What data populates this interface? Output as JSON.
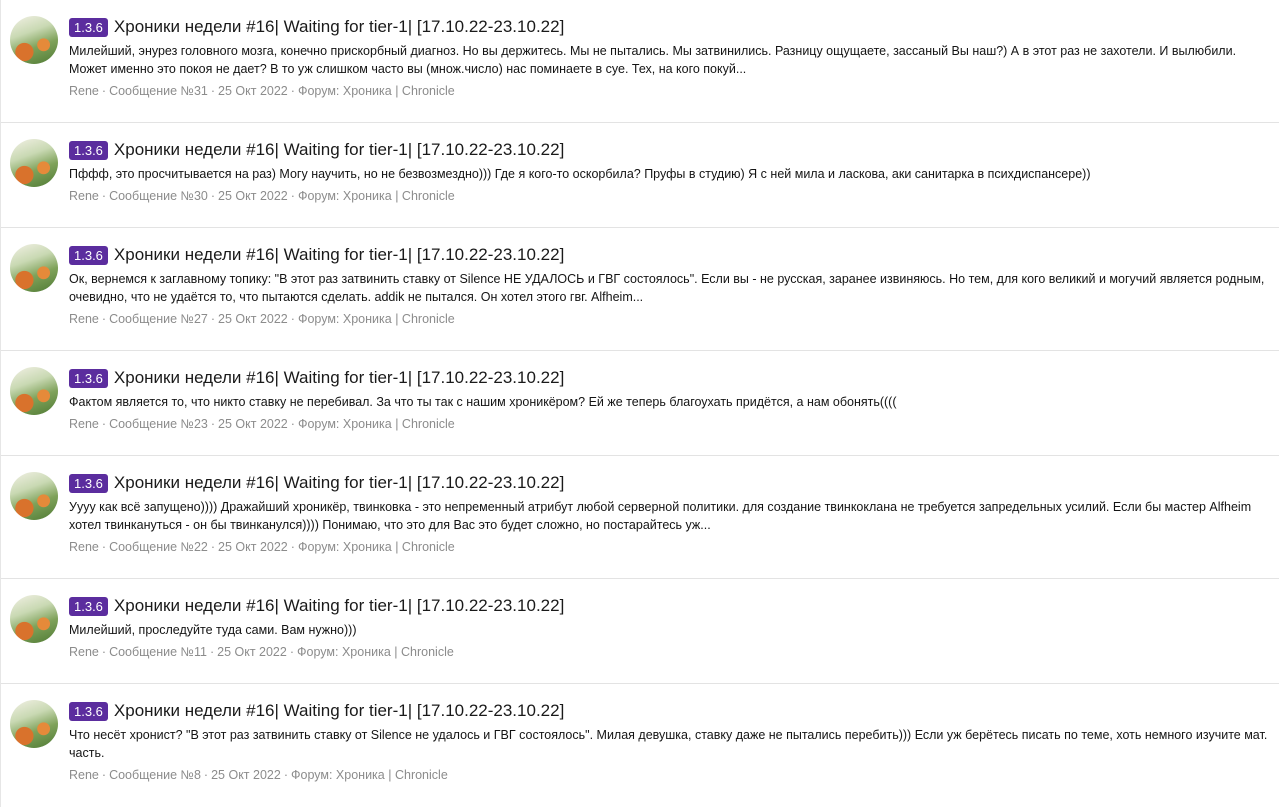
{
  "results": [
    {
      "version": "1.3.6",
      "title": "Хроники недели #16| Waiting for tier-1| [17.10.22-23.10.22]",
      "snippet": "Милейший, энурез головного мозга, конечно прискорбный диагноз. Но вы держитесь. Мы не пытались. Мы затвинились. Разницу ощущаете, зассаный Вы наш?) А в этот раз не захотели. И вылюбили. Может именно это покоя не дает? В то уж слишком часто вы (множ.число) нас поминаете в суе. Тех, на кого покуй...",
      "author": "Rene",
      "message": "Сообщение №31",
      "date": "25 Окт 2022",
      "forum_label": "Форум:",
      "forum": "Хроника",
      "forum_sep": "|",
      "forum_alt": "Chronicle"
    },
    {
      "version": "1.3.6",
      "title": "Хроники недели #16| Waiting for tier-1| [17.10.22-23.10.22]",
      "snippet": "Пффф, это просчитывается на раз) Могу научить, но не безвозмездно))) Где я кого-то оскорбила? Пруфы в студию) Я с ней мила и ласкова, аки санитарка в психдиспансере))",
      "author": "Rene",
      "message": "Сообщение №30",
      "date": "25 Окт 2022",
      "forum_label": "Форум:",
      "forum": "Хроника",
      "forum_sep": "|",
      "forum_alt": "Chronicle"
    },
    {
      "version": "1.3.6",
      "title": "Хроники недели #16| Waiting for tier-1| [17.10.22-23.10.22]",
      "snippet": "Ок, вернемся к заглавному топику: \"В этот раз затвинить ставку от Silence НЕ УДАЛОСЬ и ГВГ состоялось\". Если вы - не русская, заранее извиняюсь. Но тем, для кого великий и могучий является родным, очевидно, что не удаётся то, что пытаются сделать. addik не пытался. Он хотел этого гвг. Alfheim...",
      "author": "Rene",
      "message": "Сообщение №27",
      "date": "25 Окт 2022",
      "forum_label": "Форум:",
      "forum": "Хроника",
      "forum_sep": "|",
      "forum_alt": "Chronicle"
    },
    {
      "version": "1.3.6",
      "title": "Хроники недели #16| Waiting for tier-1| [17.10.22-23.10.22]",
      "snippet": "Фактом является то, что никто ставку не перебивал. За что ты так с нашим хроникёром? Ей же теперь благоухать придётся, а нам обонять((((",
      "author": "Rene",
      "message": "Сообщение №23",
      "date": "25 Окт 2022",
      "forum_label": "Форум:",
      "forum": "Хроника",
      "forum_sep": "|",
      "forum_alt": "Chronicle"
    },
    {
      "version": "1.3.6",
      "title": "Хроники недели #16| Waiting for tier-1| [17.10.22-23.10.22]",
      "snippet": "Уууу как всё запущено)))) Дражайший хроникёр, твинковка - это непременный атрибут любой серверной политики. для создание твинкоклана не требуется запредельных усилий. Если бы мастер Alfheim хотел твинкануться - он бы твинканулся)))) Понимаю, что это для Вас это будет сложно, но постарайтесь уж...",
      "author": "Rene",
      "message": "Сообщение №22",
      "date": "25 Окт 2022",
      "forum_label": "Форум:",
      "forum": "Хроника",
      "forum_sep": "|",
      "forum_alt": "Chronicle"
    },
    {
      "version": "1.3.6",
      "title": "Хроники недели #16| Waiting for tier-1| [17.10.22-23.10.22]",
      "snippet": "Милейший, проследуйте туда сами. Вам нужно)))",
      "author": "Rene",
      "message": "Сообщение №11",
      "date": "25 Окт 2022",
      "forum_label": "Форум:",
      "forum": "Хроника",
      "forum_sep": "|",
      "forum_alt": "Chronicle"
    },
    {
      "version": "1.3.6",
      "title": "Хроники недели #16| Waiting for tier-1| [17.10.22-23.10.22]",
      "snippet": "Что несёт хронист? \"В этот раз затвинить ставку от Silence не удалось и ГВГ состоялось\". Милая девушка, ставку даже не пытались перебить))) Если уж берётесь писать по теме, хоть немного изучите мат. часть.",
      "author": "Rene",
      "message": "Сообщение №8",
      "date": "25 Окт 2022",
      "forum_label": "Форум:",
      "forum": "Хроника",
      "forum_sep": "|",
      "forum_alt": "Chronicle"
    }
  ]
}
